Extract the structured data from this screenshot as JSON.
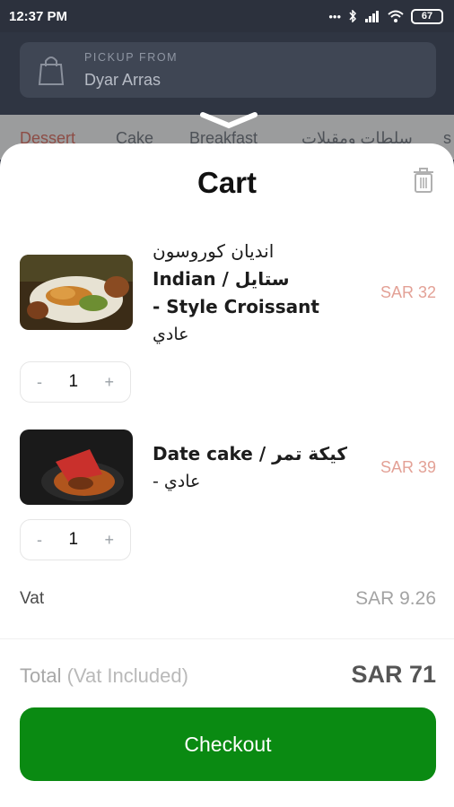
{
  "status_bar": {
    "time": "12:37 PM",
    "icons": [
      "dots-icon",
      "bluetooth-icon",
      "signal-icon",
      "wifi-icon",
      "battery-icon"
    ],
    "battery": "67"
  },
  "pickup": {
    "label": "PICKUP FROM",
    "value": "Dyar Arras",
    "icon": "shopping-bag-icon"
  },
  "categories": [
    "Dessert",
    "Cake",
    "Breakfast",
    "سلطات ومقبلات",
    "s"
  ],
  "categories_active": "Dessert",
  "cart": {
    "title": "Cart",
    "trash_icon": "trash-icon",
    "items": [
      {
        "name_ar_1": "انديان كوروسون",
        "name_line_2": "Indian / ستايل",
        "name_line_3": "- Style Croissant",
        "variant": "عادي",
        "price": "SAR 32",
        "quantity": "1",
        "minus": "-",
        "plus": "+"
      },
      {
        "name_line_1": "Date cake / كيكة تمر",
        "variant": "- عادي",
        "price": "SAR 39",
        "quantity": "1",
        "minus": "-",
        "plus": "+"
      }
    ],
    "vat_label": "Vat",
    "vat_value": "SAR 9.26",
    "total_label": "Total",
    "total_sub": "(Vat Included)",
    "total_value": "SAR 71",
    "checkout_label": "Checkout"
  },
  "colors": {
    "accent": "#0a8a12",
    "price": "#e3a196",
    "header_bg": "#2f3542"
  }
}
